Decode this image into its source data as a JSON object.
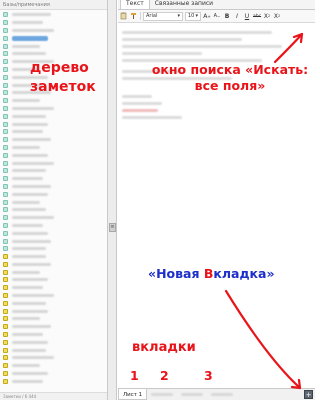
{
  "tree_panel": {
    "header": "Базы/примечания",
    "footer": "Заметки / 6 444",
    "rows": [
      {
        "kind": "note",
        "w": 28
      },
      {
        "kind": "note",
        "w": 22
      },
      {
        "kind": "note",
        "w": 30
      },
      {
        "kind": "note",
        "w": 26,
        "selected": true
      },
      {
        "kind": "note",
        "w": 20
      },
      {
        "kind": "note",
        "w": 24
      },
      {
        "kind": "note",
        "w": 30
      },
      {
        "kind": "note",
        "w": 18
      },
      {
        "kind": "note",
        "w": 26
      },
      {
        "kind": "note",
        "w": 22
      },
      {
        "kind": "note",
        "w": 28
      },
      {
        "kind": "note",
        "w": 20
      },
      {
        "kind": "note",
        "w": 30
      },
      {
        "kind": "note",
        "w": 24
      },
      {
        "kind": "note",
        "w": 26
      },
      {
        "kind": "note",
        "w": 22
      },
      {
        "kind": "note",
        "w": 28
      },
      {
        "kind": "note",
        "w": 20
      },
      {
        "kind": "note",
        "w": 26
      },
      {
        "kind": "note",
        "w": 30
      },
      {
        "kind": "note",
        "w": 24
      },
      {
        "kind": "note",
        "w": 22
      },
      {
        "kind": "note",
        "w": 28
      },
      {
        "kind": "note",
        "w": 26
      },
      {
        "kind": "note",
        "w": 20
      },
      {
        "kind": "note",
        "w": 24
      },
      {
        "kind": "note",
        "w": 30
      },
      {
        "kind": "note",
        "w": 22
      },
      {
        "kind": "note",
        "w": 26
      },
      {
        "kind": "note",
        "w": 28
      },
      {
        "kind": "note",
        "w": 24
      },
      {
        "kind": "folder",
        "w": 24
      },
      {
        "kind": "folder",
        "w": 28
      },
      {
        "kind": "folder",
        "w": 20
      },
      {
        "kind": "folder",
        "w": 26
      },
      {
        "kind": "folder",
        "w": 22
      },
      {
        "kind": "folder",
        "w": 30
      },
      {
        "kind": "folder",
        "w": 24
      },
      {
        "kind": "folder",
        "w": 26
      },
      {
        "kind": "folder",
        "w": 20
      },
      {
        "kind": "folder",
        "w": 28
      },
      {
        "kind": "folder",
        "w": 22
      },
      {
        "kind": "folder",
        "w": 26
      },
      {
        "kind": "folder",
        "w": 24
      },
      {
        "kind": "folder",
        "w": 30
      },
      {
        "kind": "folder",
        "w": 20
      },
      {
        "kind": "folder",
        "w": 26
      },
      {
        "kind": "folder",
        "w": 22
      }
    ]
  },
  "editor": {
    "tabs": [
      "Текст",
      "Связанные записи"
    ],
    "font": "Arial",
    "size": "10",
    "format_buttons": [
      "A",
      "A",
      "B",
      "I",
      "U",
      "abc",
      "X",
      "X"
    ]
  },
  "note_tabs": {
    "active": "Лист 1",
    "new_tab_symbol": "+"
  },
  "annotations": {
    "tree": "дерево заметок",
    "search": "окно поиска «Искать: все поля»",
    "new_tab_prefix": "«Новая ",
    "new_tab_k": "В",
    "new_tab_suffix": "кладка»",
    "tabs": "вкладки",
    "num1": "1",
    "num2": "2",
    "num3": "3"
  },
  "colors": {
    "annotation_red": "#e8141a",
    "annotation_blue": "#1c2fc9"
  }
}
